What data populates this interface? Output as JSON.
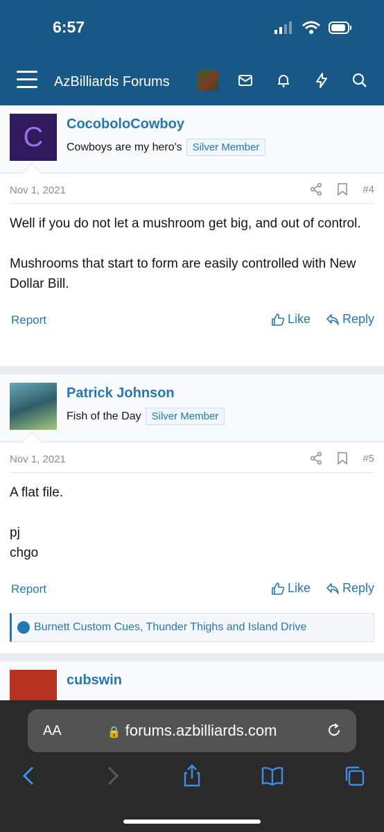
{
  "status": {
    "time": "6:57"
  },
  "nav": {
    "title": "AzBilliards Forums"
  },
  "posts": [
    {
      "avatar_letter": "C",
      "username": "CocoboloCowboy",
      "user_title": "Cowboys are my hero's",
      "badge": "Silver Member",
      "date": "Nov 1, 2021",
      "number": "#4",
      "paragraphs": [
        "Well if you do not let a mushroom get big, and out of control.",
        "Mushrooms that start to form are easily controlled with New Dollar Bill."
      ],
      "report": "Report",
      "like": "Like",
      "reply": "Reply"
    },
    {
      "username": "Patrick Johnson",
      "user_title": "Fish of the Day",
      "badge": "Silver Member",
      "date": "Nov 1, 2021",
      "number": "#5",
      "lines": [
        "A flat file.",
        "",
        "pj",
        "chgo"
      ],
      "report": "Report",
      "like": "Like",
      "reply": "Reply",
      "likes": "Burnett Custom Cues, Thunder Thighs and Island Drive"
    },
    {
      "username": "cubswin"
    }
  ],
  "safari": {
    "aa": "AA",
    "url": "forums.azbilliards.com"
  },
  "colors": {
    "brand": "#185886",
    "link": "#2577b1"
  }
}
